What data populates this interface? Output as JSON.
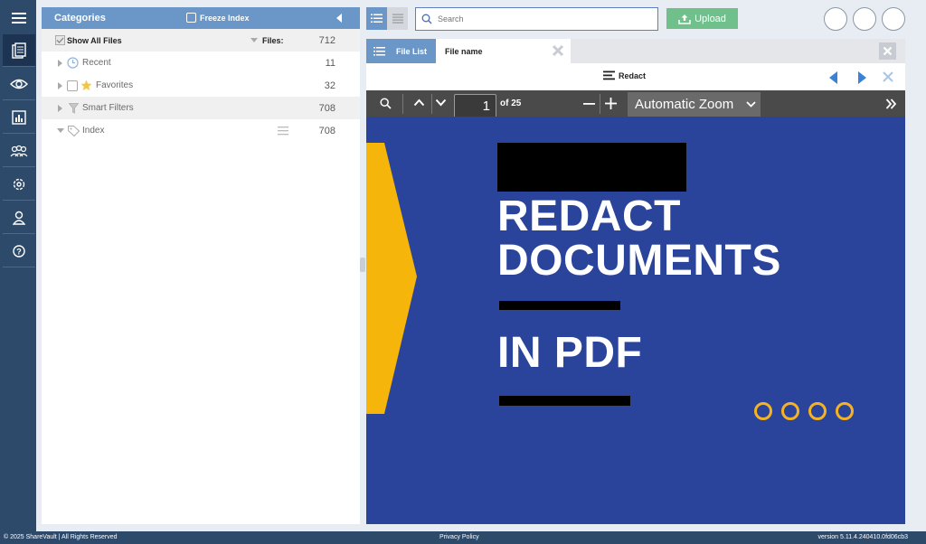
{
  "categories": {
    "title": "Categories",
    "freeze_label": "Freeze Index",
    "show_all_label": "Show All Files",
    "files_label": "Files:",
    "files_count": "712",
    "items": [
      {
        "label": "Recent",
        "count": "11"
      },
      {
        "label": "Favorites",
        "count": "32"
      },
      {
        "label": "Smart Filters",
        "count": "708"
      },
      {
        "label": "Index",
        "count": "708"
      }
    ]
  },
  "search": {
    "placeholder": "Search"
  },
  "toolbar": {
    "upload_label": "Upload"
  },
  "tabs": {
    "file_list": "File List",
    "file_name": "File name"
  },
  "viewer": {
    "redact_label": "Redact",
    "page_number": "1",
    "page_of": "of 25",
    "zoom": "Automatic Zoom"
  },
  "document": {
    "line1": "REDACT",
    "line2": "DOCUMENTS",
    "line3": "IN PDF"
  },
  "colors": {
    "rail": "#2d4a6b",
    "header_blue": "#6a97c8",
    "upload_green": "#6fc08a",
    "page_blue": "#2a449b",
    "accent_yellow": "#f5b324"
  },
  "footer": {
    "copyright": "© 2025 ShareVault | All Rights Reserved",
    "privacy": "Privacy Policy",
    "version": "version 5.11.4.240410.0fd06cb3"
  }
}
